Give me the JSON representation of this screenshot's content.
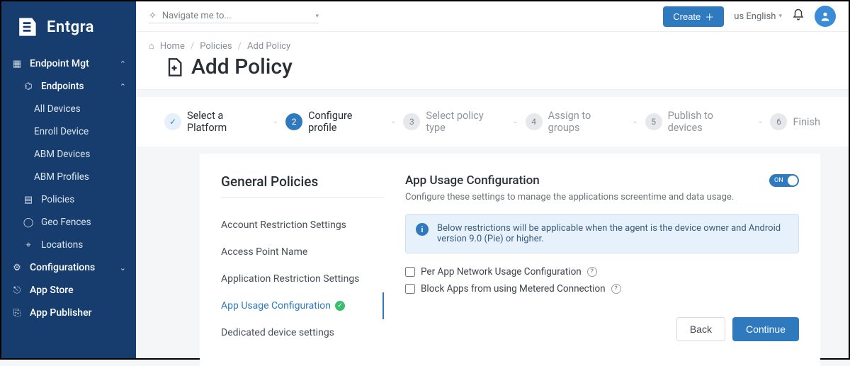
{
  "brand": "Entgra",
  "topbar": {
    "navigate_placeholder": "Navigate me to...",
    "create_label": "Create",
    "language": "us English"
  },
  "sidebar": {
    "endpoint_section": "Endpoint Mgt",
    "endpoints_label": "Endpoints",
    "endpoint_items": [
      "All Devices",
      "Enroll Device",
      "ABM Devices",
      "ABM Profiles"
    ],
    "policies": "Policies",
    "geo_fences": "Geo Fences",
    "locations": "Locations",
    "configurations": "Configurations",
    "app_store": "App Store",
    "app_publisher": "App Publisher"
  },
  "breadcrumb": {
    "home": "Home",
    "policies": "Policies",
    "add_policy": "Add Policy"
  },
  "page_title": "Add Policy",
  "stepper": {
    "step1": "Select a Platform",
    "step2": "Configure profile",
    "step3": "Select policy type",
    "step4": "Assign to groups",
    "step5": "Publish to devices",
    "step6": "Finish"
  },
  "policy_list": {
    "heading": "General Policies",
    "items": [
      "Account Restriction Settings",
      "Access Point Name",
      "Application Restriction Settings",
      "App Usage Configuration",
      "Dedicated device settings"
    ],
    "selected_index": 3
  },
  "config": {
    "title": "App Usage Configuration",
    "toggle_label": "ON",
    "subtitle": "Configure these settings to manage the applications screentime and data usage.",
    "info": "Below restrictions will be applicable when the agent is the device owner and Android version 9.0 (Pie) or higher.",
    "opt1": "Per App Network Usage Configuration",
    "opt2": "Block Apps from using Metered Connection",
    "back": "Back",
    "continue": "Continue"
  }
}
